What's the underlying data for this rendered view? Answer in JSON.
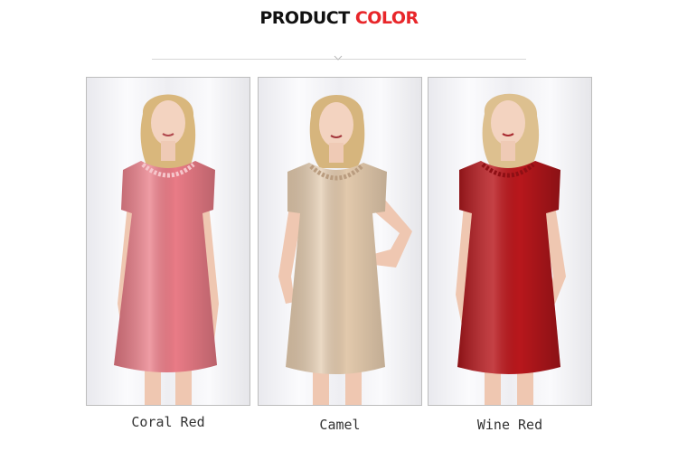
{
  "heading": {
    "word1": "PRODUCT",
    "word2": "COLOR"
  },
  "colors": {
    "heading_accent": "#e8262a",
    "divider": "#d7d7d7"
  },
  "products": [
    {
      "name": "Coral Red",
      "color": "#e97b86"
    },
    {
      "name": "Camel",
      "color": "#e2c9ac"
    },
    {
      "name": "Wine Red",
      "color": "#b8171c"
    }
  ]
}
